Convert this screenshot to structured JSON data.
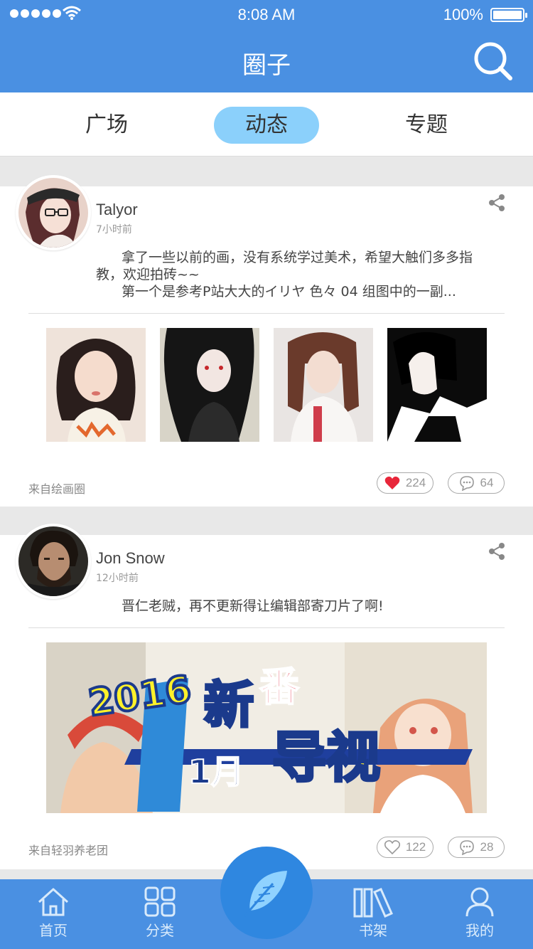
{
  "status": {
    "time": "8:08 AM",
    "battery": "100%"
  },
  "header": {
    "title": "圈子"
  },
  "tabs": [
    {
      "label": "广场"
    },
    {
      "label": "动态",
      "active": true
    },
    {
      "label": "专题"
    }
  ],
  "posts": [
    {
      "user": "Talyor",
      "time": "7小时前",
      "lines": [
        "拿了一些以前的画，没有系统学过美术，希望大触们多多指",
        "教，欢迎拍砖~~",
        "第一个是参考P站大大的イリヤ 色々 04 组图中的一副..."
      ],
      "source": "来自绘画圈",
      "likes": "224",
      "liked": true,
      "comments": "64"
    },
    {
      "user": "Jon Snow",
      "time": "12小时前",
      "lines": [
        "晋仁老贼，再不更新得让编辑部寄刀片了啊!"
      ],
      "banner": {
        "year": "2016",
        "month": "1月",
        "title_a": "新",
        "title_b": "番",
        "title_c": "导视"
      },
      "source": "来自轻羽养老团",
      "likes": "122",
      "liked": false,
      "comments": "28"
    }
  ],
  "nav": [
    {
      "label": "首页"
    },
    {
      "label": "分类"
    },
    {
      "label": "书架"
    },
    {
      "label": "我的"
    }
  ],
  "colors": {
    "brand": "#4a90e2",
    "active_tab": "#8bd0fb",
    "like": "#e8263a"
  }
}
